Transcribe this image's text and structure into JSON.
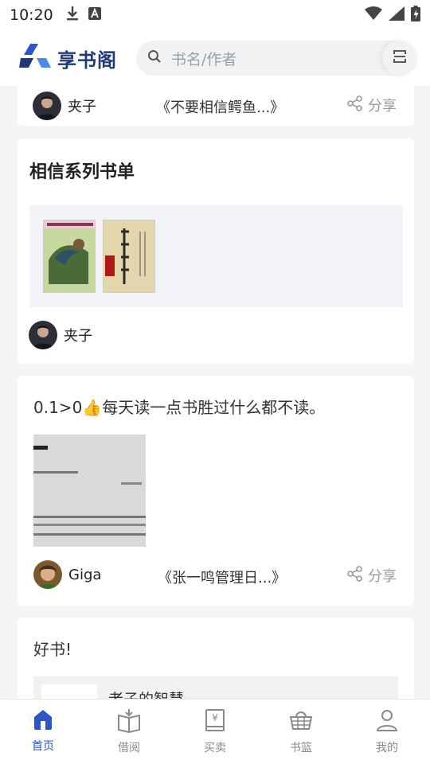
{
  "status_bar": {
    "time": "10:20"
  },
  "header": {
    "logo_text": "享书阁",
    "search_placeholder": "书名/作者"
  },
  "feed": {
    "card1": {
      "user": "夹子",
      "book": "《不要相信鳄鱼...》",
      "share": "分享"
    },
    "card2": {
      "title": "相信系列书单",
      "user": "夹子"
    },
    "card3": {
      "text": "0.1>0👍每天读一点书胜过什么都不读。",
      "user": "Giga",
      "book": "《张一鸣管理日...》",
      "share": "分享"
    },
    "card4": {
      "text": "好书!",
      "book_title": "老子的智慧"
    }
  },
  "nav": {
    "items": [
      {
        "label": "首页",
        "icon": "home-icon"
      },
      {
        "label": "借阅",
        "icon": "borrow-icon"
      },
      {
        "label": "买卖",
        "icon": "trade-icon"
      },
      {
        "label": "书篮",
        "icon": "basket-icon"
      },
      {
        "label": "我的",
        "icon": "profile-icon"
      }
    ]
  },
  "colors": {
    "brand": "#2a56c6",
    "logo": "#1e3a7b"
  }
}
